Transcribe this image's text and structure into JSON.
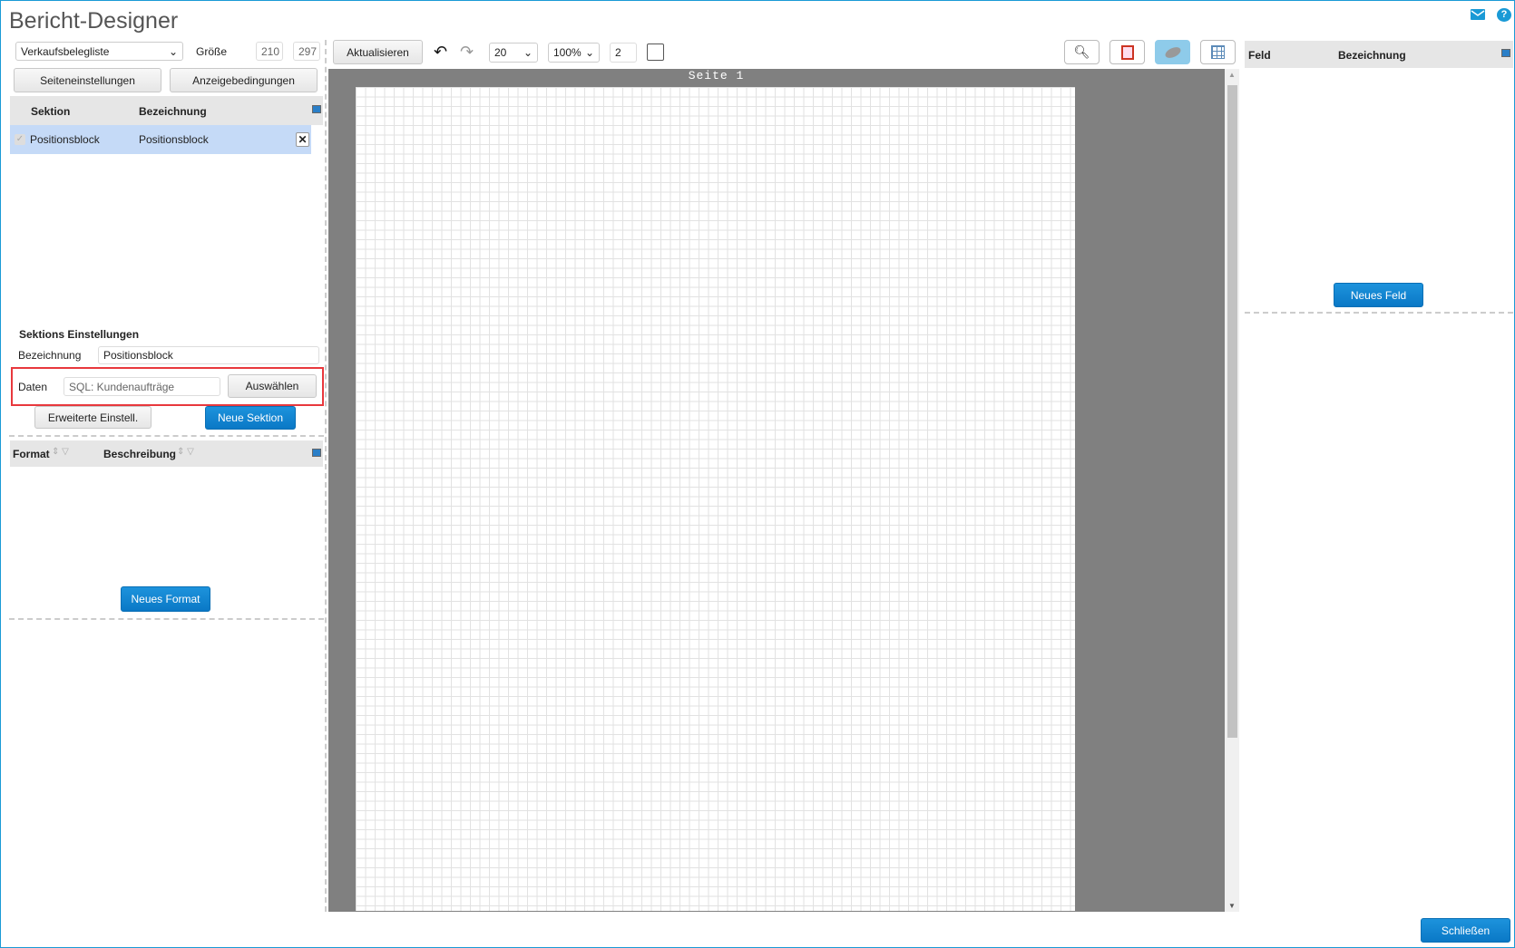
{
  "title": "Bericht-Designer",
  "left": {
    "report_select": "Verkaufsbelegliste",
    "size_label": "Größe",
    "width": "210",
    "height": "297",
    "page_settings": "Seiteneinstellungen",
    "display_conditions": "Anzeigebedingungen",
    "sections_table": {
      "headers": [
        "Sektion",
        "Bezeichnung"
      ],
      "rows": [
        {
          "section": "Positionsblock",
          "name": "Positionsblock",
          "checked": true
        }
      ]
    },
    "section_settings": {
      "title": "Sektions Einstellungen",
      "name_label": "Bezeichnung",
      "name_value": "Positionsblock",
      "data_label": "Daten",
      "data_value": "SQL: Kundenaufträge",
      "select_button": "Auswählen",
      "advanced_button": "Erweiterte Einstell.",
      "new_section_button": "Neue Sektion"
    },
    "formats_table": {
      "headers": [
        "Format",
        "Beschreibung"
      ]
    },
    "new_format_button": "Neues Format"
  },
  "toolbar": {
    "refresh": "Aktualisieren",
    "grid_size": "20",
    "zoom": "100%",
    "page_input": "2"
  },
  "canvas": {
    "page_label": "Seite 1"
  },
  "right": {
    "headers": [
      "Feld",
      "Bezeichnung"
    ],
    "new_field_button": "Neues Feld"
  },
  "close_button": "Schließen",
  "colors": {
    "accent": "#0a78c6",
    "highlight": "#c5daf7",
    "canvas_bg": "#808080",
    "red_frame": "#e8383d"
  }
}
